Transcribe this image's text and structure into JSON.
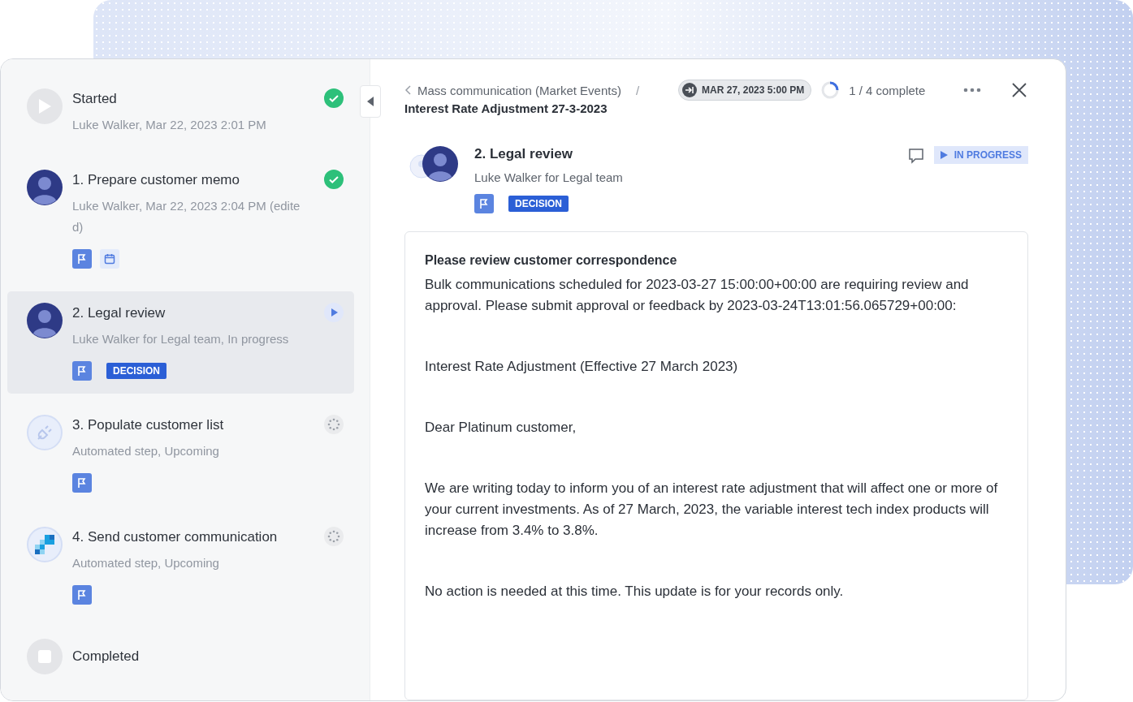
{
  "steps": [
    {
      "kind": "start",
      "title": "Started",
      "subtitle": "Luke Walker, Mar 22, 2023 2:01 PM",
      "status": {
        "kind": "done"
      },
      "selected": false
    },
    {
      "kind": "step",
      "avatar": {
        "kind": "person"
      },
      "number": "1.",
      "title": "Prepare customer memo",
      "subtitle": "Luke Walker, Mar 22, 2023 2:04 PM (edite d)",
      "status": {
        "kind": "done"
      },
      "selected": false,
      "tags": [
        {
          "kind": "flag"
        },
        {
          "kind": "calendar"
        }
      ]
    },
    {
      "kind": "step",
      "avatar": {
        "kind": "person"
      },
      "number": "2.",
      "title": "Legal review",
      "subtitle": "Luke Walker for Legal team, In progress",
      "status": {
        "kind": "in_progress"
      },
      "selected": true,
      "tags": [
        {
          "kind": "flag"
        },
        {
          "kind": "label",
          "text": "DECISION"
        }
      ]
    },
    {
      "kind": "step",
      "avatar": {
        "kind": "plug"
      },
      "number": "3.",
      "title": "Populate customer list",
      "subtitle": "Automated step, Upcoming",
      "status": {
        "kind": "upcoming"
      },
      "selected": false,
      "tags": [
        {
          "kind": "flag"
        }
      ]
    },
    {
      "kind": "step",
      "avatar": {
        "kind": "blocks"
      },
      "number": "4.",
      "title": "Send customer communication",
      "subtitle": "Automated step, Upcoming",
      "status": {
        "kind": "upcoming"
      },
      "selected": false,
      "tags": [
        {
          "kind": "flag"
        }
      ]
    },
    {
      "kind": "end",
      "title": "Completed",
      "selected": false
    }
  ],
  "header": {
    "breadcrumb": "Mass communication (Market Events)",
    "separator": "/",
    "due": "MAR 27, 2023 5:00 PM",
    "progress": {
      "text": "1 / 4 complete"
    },
    "title": "Interest Rate Adjustment 27-3-2023"
  },
  "detail": {
    "title": "2. Legal review",
    "subtitle": "Luke Walker for Legal team",
    "status": "IN PROGRESS",
    "tags": [
      {
        "kind": "flag"
      },
      {
        "kind": "label",
        "text": "DECISION"
      }
    ]
  },
  "message": {
    "heading": "Please review customer correspondence",
    "paragraphs": [
      "Bulk communications scheduled for 2023-03-27 15:00:00+00:00 are requiring review and approval. Please submit approval or feedback by 2023-03-24T13:01:56.065729+00:00:",
      "Interest Rate Adjustment (Effective 27 March 2023)",
      "Dear Platinum customer,",
      "We are writing today to inform you of an interest rate adjustment that will affect one or more of your current investments. As of 27 March, 2023, the variable interest tech index products will increase from 3.4% to 3.8%.",
      "No action is needed at this time. This update is for your records only."
    ]
  }
}
